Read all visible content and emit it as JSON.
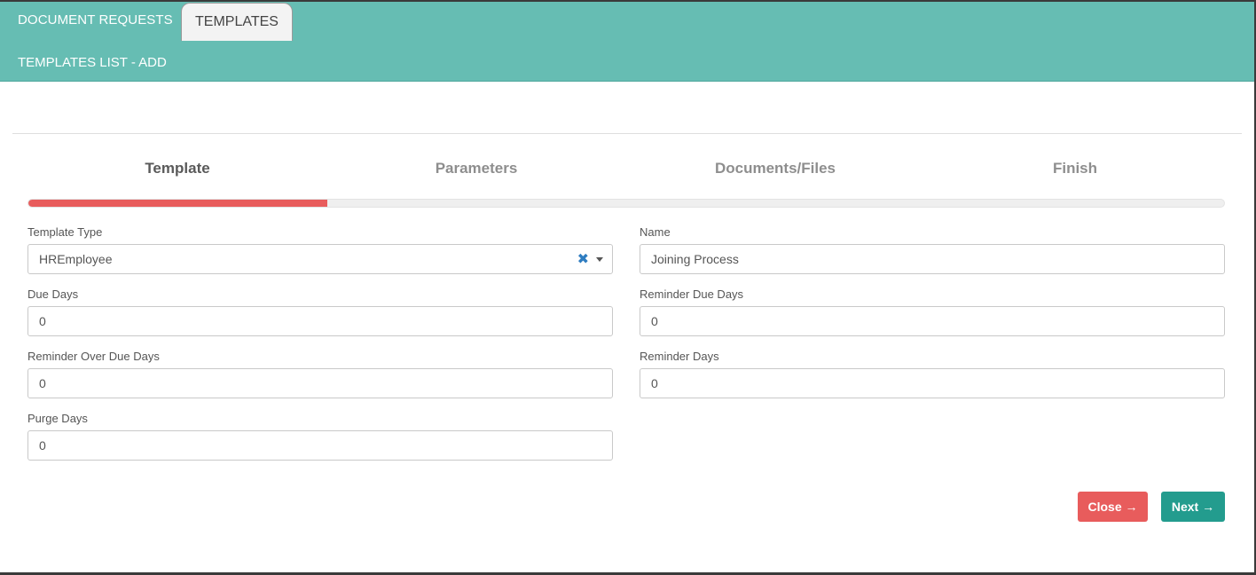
{
  "header": {
    "tabs": [
      {
        "label": "DOCUMENT REQUESTS",
        "active": false
      },
      {
        "label": "TEMPLATES",
        "active": true
      }
    ],
    "page_title": "TEMPLATES LIST - ADD"
  },
  "wizard": {
    "steps": [
      "Template",
      "Parameters",
      "Documents/Files",
      "Finish"
    ],
    "active_step": 0,
    "progress_fraction": 0.25
  },
  "form": {
    "template_type": {
      "label": "Template Type",
      "value": "HREmployee"
    },
    "name": {
      "label": "Name",
      "value": "Joining Process"
    },
    "due_days": {
      "label": "Due Days",
      "value": "0"
    },
    "reminder_due_days": {
      "label": "Reminder Due Days",
      "value": "0"
    },
    "reminder_over_due_days": {
      "label": "Reminder Over Due Days",
      "value": "0"
    },
    "reminder_days": {
      "label": "Reminder Days",
      "value": "0"
    },
    "purge_days": {
      "label": "Purge Days",
      "value": "0"
    }
  },
  "actions": {
    "close_label": "Close →",
    "next_label": "Next →"
  },
  "colors": {
    "header_bg": "#66bdb3",
    "progress": "#e85c5c",
    "close_button": "#e85c5c",
    "next_button": "#239c8e"
  },
  "icons": {
    "clear": "clear-icon",
    "dropdown": "caret-down-icon"
  }
}
